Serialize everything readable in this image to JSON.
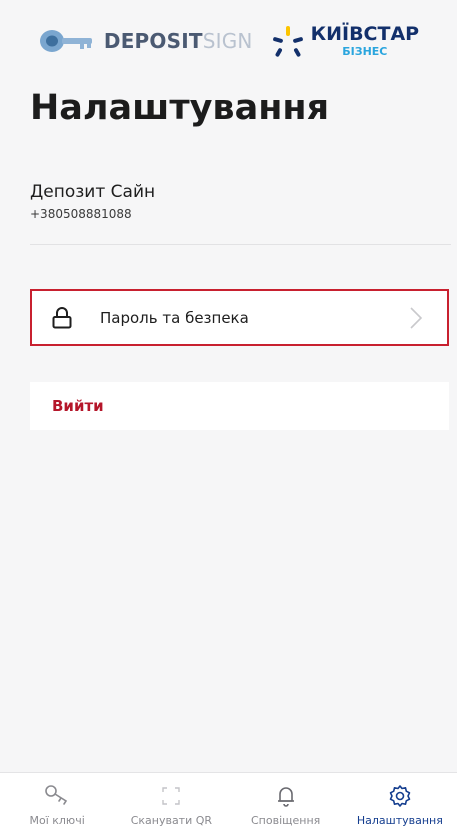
{
  "header": {
    "deposit_logo_bold": "DEPOSIT",
    "deposit_logo_light": "SIGN",
    "kyivstar_name": "КИЇВСТАР",
    "kyivstar_sub": "БІЗНЕС"
  },
  "page_title": "Налаштування",
  "profile": {
    "name": "Депозит Сайн",
    "phone": "+380508881088"
  },
  "menu": {
    "security_label": "Пароль та безпека",
    "security_icon": "lock-icon",
    "logout_label": "Вийти"
  },
  "tabbar": {
    "items": [
      {
        "label": "Мої ключі",
        "icon": "key-icon",
        "active": false
      },
      {
        "label": "Сканувати QR",
        "icon": "scan-icon",
        "active": false
      },
      {
        "label": "Сповіщення",
        "icon": "bell-icon",
        "active": false
      },
      {
        "label": "Налаштування",
        "icon": "gear-icon",
        "active": true
      }
    ]
  },
  "colors": {
    "accent_red": "#c8202f",
    "logout_red": "#b5162a",
    "active_blue": "#153e8f",
    "background": "#f6f6f7"
  }
}
